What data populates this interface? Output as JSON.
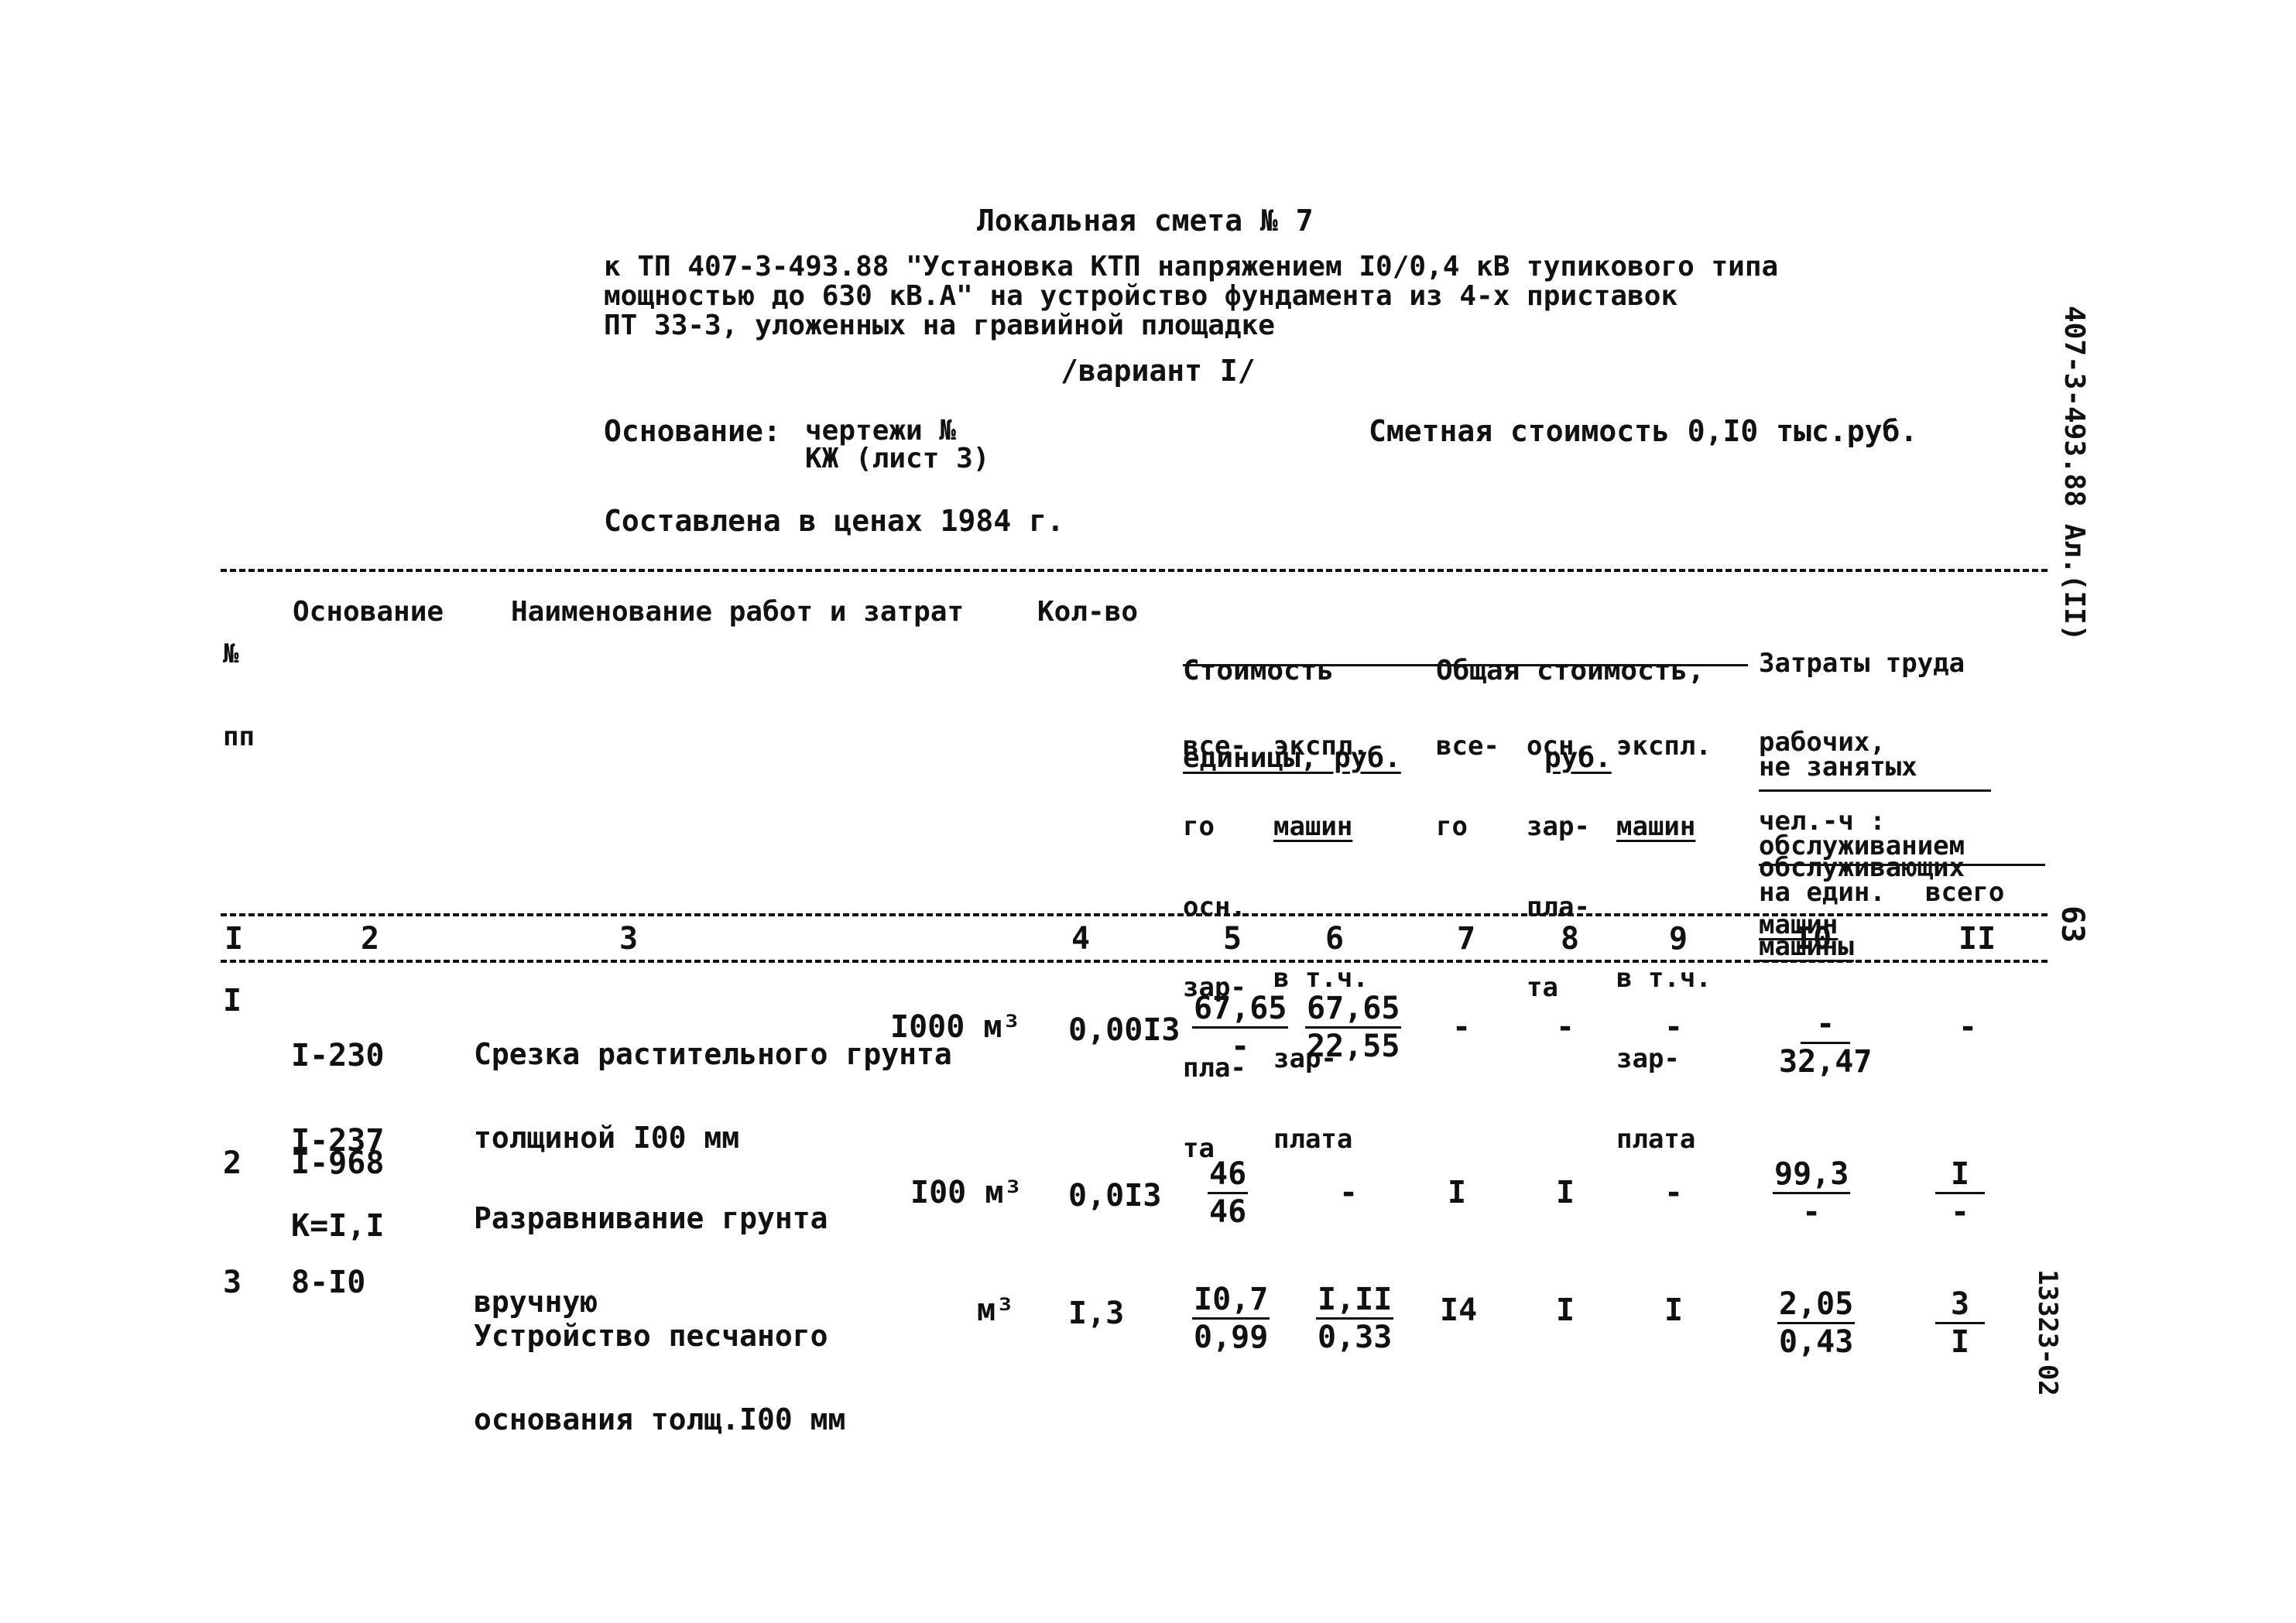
{
  "header": {
    "title": "Локальная смета № 7",
    "subtitle_lines": [
      "к ТП 407-3-493.88 \"Установка КТП напряжением I0/0,4 кВ тупикового типа",
      "мощностью до 630 кВ.А\" на устройство фундамента из 4-х приставок",
      "ПТ 33-3, уложенных на гравийной площадке"
    ],
    "variant": "/вариант I/",
    "basis_label": "Основание:",
    "basis_line1": "чертежи №",
    "basis_line2": "КЖ (лист 3)",
    "estimated_cost": "Сметная стоимость 0,I0 тыс.руб.",
    "prices_year": "Составлена в ценах 1984 г."
  },
  "side": {
    "doc_code": "407-3-493.88 Ал.(II)",
    "page_number": "63",
    "archive_number": "13323-02"
  },
  "table": {
    "headers": {
      "num": [
        "№",
        "пп"
      ],
      "basis": "Основание",
      "name": "Наименование работ и затрат",
      "qty": "Кол-во",
      "unit_cost": [
        "Стоимость",
        "единицы, руб."
      ],
      "unit_cost_sub1": [
        "все-",
        "го",
        "осн.",
        "зар-",
        "пла-",
        "та"
      ],
      "unit_cost_sub2_top": [
        "экспл.",
        "машин"
      ],
      "unit_cost_sub2_bottom": [
        "в т.ч.",
        "зар-",
        "плата"
      ],
      "total_cost": [
        "Общая стоимость,",
        "руб."
      ],
      "total_sub1": [
        "все-",
        "го"
      ],
      "total_sub2": [
        "осн.",
        "зар-",
        "пла-",
        "та"
      ],
      "total_sub3_top": [
        "экспл.",
        "машин"
      ],
      "total_sub3_bottom": [
        "в т.ч.",
        "зар-",
        "плата"
      ],
      "labor": [
        "Затраты труда",
        "рабочих,",
        "чел.-ч :"
      ],
      "labor_sub1": [
        "не занятых",
        "обслуживанием",
        "машин"
      ],
      "labor_sub2": [
        "обслуживающих",
        "машины"
      ],
      "labor_per_unit": "на един.",
      "labor_total": "всего"
    },
    "column_numbers": [
      "I",
      "2",
      "3",
      "4",
      "5",
      "6",
      "7",
      "8",
      "9",
      "I0",
      "II"
    ],
    "rows": [
      {
        "num": "I",
        "basis": [
          "I-230",
          "I-237",
          "К=I,I"
        ],
        "name": [
          "Срезка растительного грунта",
          "толщиной I00 мм"
        ],
        "unit": "I000 м³",
        "qty": "0,00I3",
        "c5": {
          "top": "67,65",
          "bottom": "-"
        },
        "c6": {
          "top": "67,65",
          "bottom": "22,55"
        },
        "c7": "-",
        "c8": "-",
        "c9": "-",
        "c10": {
          "top": "-",
          "bottom": "32,47"
        },
        "c11": "-"
      },
      {
        "num": "2",
        "basis": [
          "I-968"
        ],
        "name": [
          "Разравнивание грунта",
          "вручную"
        ],
        "unit": "I00 м³",
        "qty": "0,0I3",
        "c5": {
          "top": "46",
          "bottom": "46"
        },
        "c6": "-",
        "c7": "I",
        "c8": "I",
        "c9": "-",
        "c10": {
          "top": "99,3",
          "bottom": "-"
        },
        "c11": {
          "top": "I",
          "bottom": "-"
        }
      },
      {
        "num": "3",
        "basis": [
          "8-I0"
        ],
        "name": [
          "Устройство песчаного",
          "основания толщ.I00 мм"
        ],
        "unit": "м³",
        "qty": "I,3",
        "c5": {
          "top": "I0,7",
          "bottom": "0,99"
        },
        "c6": {
          "top": "I,II",
          "bottom": "0,33"
        },
        "c7": "I4",
        "c8": "I",
        "c9": "I",
        "c10": {
          "top": "2,05",
          "bottom": "0,43"
        },
        "c11": {
          "top": "3",
          "bottom": "I"
        }
      }
    ]
  }
}
